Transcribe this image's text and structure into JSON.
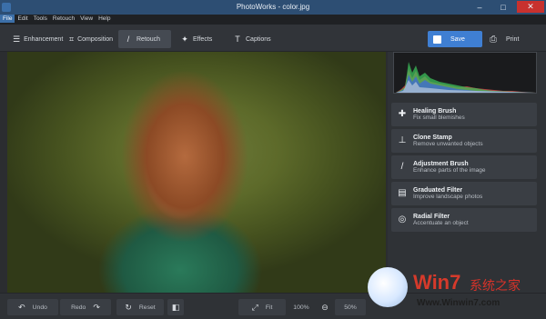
{
  "window": {
    "title": "PhotoWorks - color.jpg",
    "controls": {
      "minimize": "–",
      "maximize": "□",
      "close": "✕"
    }
  },
  "menubar": {
    "items": [
      "File",
      "Edit",
      "Tools",
      "Retouch",
      "View",
      "Help"
    ],
    "active": "File"
  },
  "toolbar": {
    "tabs": [
      {
        "label": "Enhancement",
        "icon": "sliders-icon"
      },
      {
        "label": "Composition",
        "icon": "crop-icon"
      },
      {
        "label": "Retouch",
        "icon": "brush-icon",
        "active": true
      },
      {
        "label": "Effects",
        "icon": "magic-wand-icon"
      },
      {
        "label": "Captions",
        "icon": "text-icon"
      }
    ],
    "save_label": "Save",
    "print_label": "Print"
  },
  "side_panel": {
    "tools": [
      {
        "title": "Healing Brush",
        "subtitle": "Fix small blemishes",
        "icon": "bandage-icon"
      },
      {
        "title": "Clone Stamp",
        "subtitle": "Remove unwanted objects",
        "icon": "stamp-icon"
      },
      {
        "title": "Adjustment Brush",
        "subtitle": "Enhance parts of the image",
        "icon": "brush-icon"
      },
      {
        "title": "Graduated Filter",
        "subtitle": "Improve landscape photos",
        "icon": "gradient-icon"
      },
      {
        "title": "Radial Filter",
        "subtitle": "Accentuate an object",
        "icon": "radial-icon"
      }
    ]
  },
  "bottombar": {
    "undo_label": "Undo",
    "redo_label": "Redo",
    "reset_label": "Reset",
    "fit_label": "Fit",
    "zoom_100_label": "100%",
    "zoom_label": "50%"
  },
  "watermark": {
    "brand": "Win7",
    "chinese": "系统之家",
    "url": "Www.Winwin7.com"
  },
  "colors": {
    "accent": "#3f7fd3",
    "titlebar": "#2d4e73",
    "close": "#c8312e",
    "panel": "#2f3236"
  }
}
